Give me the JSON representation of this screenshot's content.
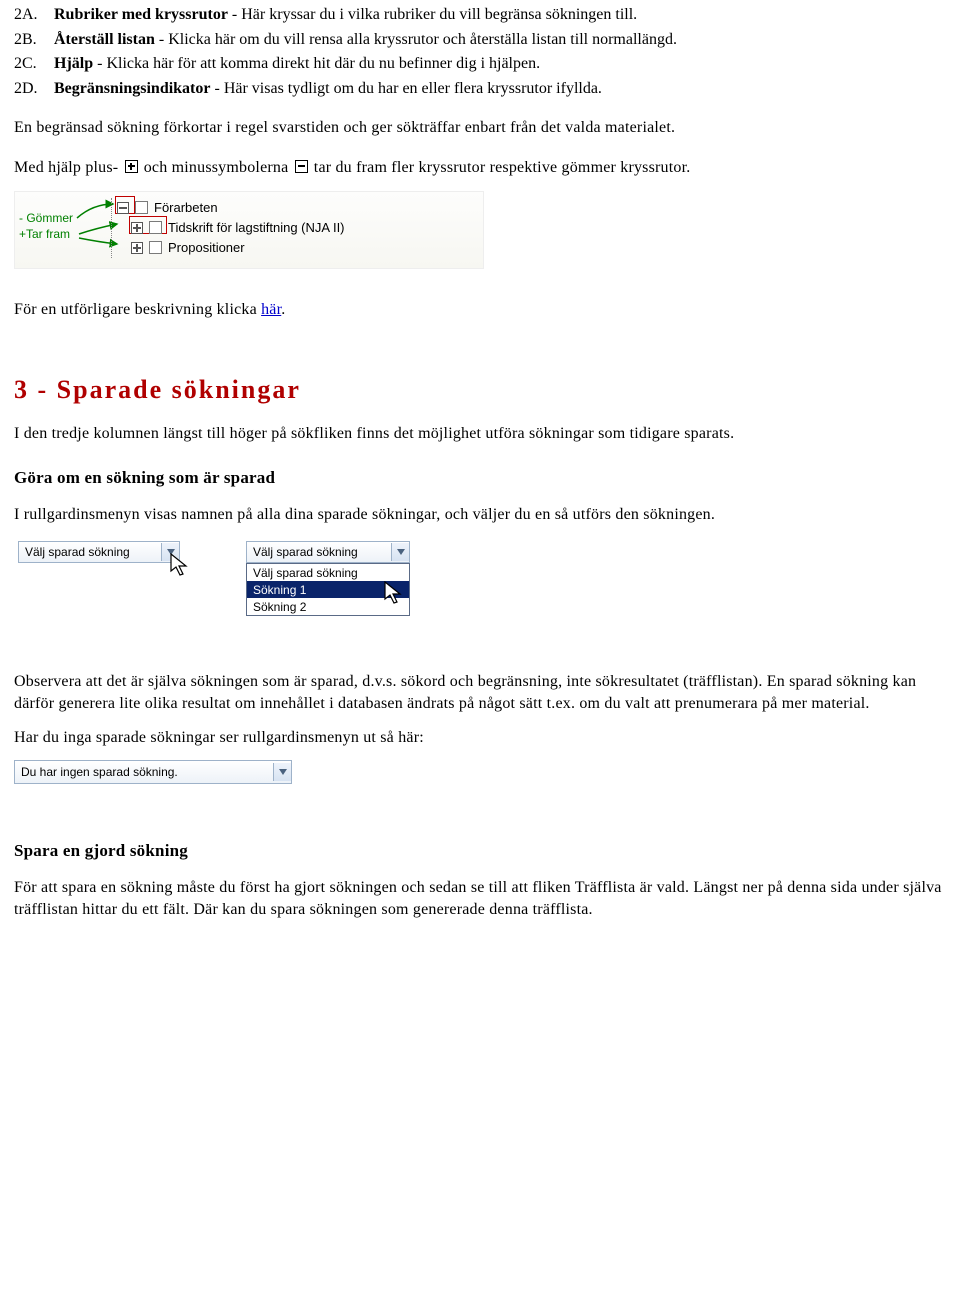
{
  "list": {
    "a_marker": "2A.",
    "a_label": "Rubriker med kryssrutor",
    "a_text": " - Här kryssar du i vilka rubriker du vill begränsa sökningen till.",
    "b_marker": "2B.",
    "b_label": "Återställ listan",
    "b_text": " - Klicka här om du vill rensa alla kryssrutor och återställa listan till normallängd.",
    "c_marker": "2C.",
    "c_label": "Hjälp",
    "c_text": " - Klicka här för att komma direkt hit där du nu befinner dig i hjälpen.",
    "d_marker": "2D.",
    "d_label": "Begränsningsindikator",
    "d_text": " - Här visas tydligt om du har en eller flera kryssrutor ifyllda."
  },
  "p_limit": "En begränsad sökning förkortar i regel svarstiden och ger sökträffar enbart från det valda materialet.",
  "p_symbols_a": "Med hjälp plus- ",
  "p_symbols_b": " och minussymbolerna ",
  "p_symbols_c": " tar du fram fler kryssrutor respektive gömmer kryssrutor.",
  "fig1": {
    "hide_label": "- Gömmer",
    "show_label": "+Tar fram",
    "items": [
      "Förarbeten",
      "Tidskrift för lagstiftning (NJA II)",
      "Propositioner"
    ]
  },
  "p_more_a": "För en utförligare beskrivning klicka ",
  "p_more_link": "här",
  "p_more_b": ".",
  "section3_title": "3 - Sparade sökningar",
  "p3_intro": "I den tredje kolumnen längst till höger på sökfliken finns det möjlighet utföra sökningar som tidigare sparats.",
  "sub_redo": "Göra om en sökning som är sparad",
  "p3_menu": "I rullgardinsmenyn visas namnen på alla dina sparade sökningar, och väljer du en så utförs den sökningen.",
  "fig2": {
    "dd1_text": "Välj sparad sökning",
    "dd2_text": "Välj sparad sökning",
    "options": [
      "Välj sparad sökning",
      "Sökning 1",
      "Sökning 2"
    ]
  },
  "p3_observe": "Observera att det är själva sökningen som är sparad, d.v.s. sökord och begränsning, inte sökresultatet (träfflistan). En sparad sökning kan därför generera lite olika resultat om innehållet i databasen ändrats på något sätt t.ex. om du valt att prenumerara på mer material.",
  "p3_none": "Har du inga sparade sökningar ser rullgardinsmenyn ut så här:",
  "fig3_text": "Du har ingen sparad sökning.",
  "sub_save": "Spara en gjord sökning",
  "p_save": "För att spara en sökning måste du först ha gjort sökningen och sedan se till att fliken Träfflista är vald. Längst ner på denna sida under själva träfflistan hittar du ett fält. Där kan du spara sökningen som genererade denna träfflista."
}
